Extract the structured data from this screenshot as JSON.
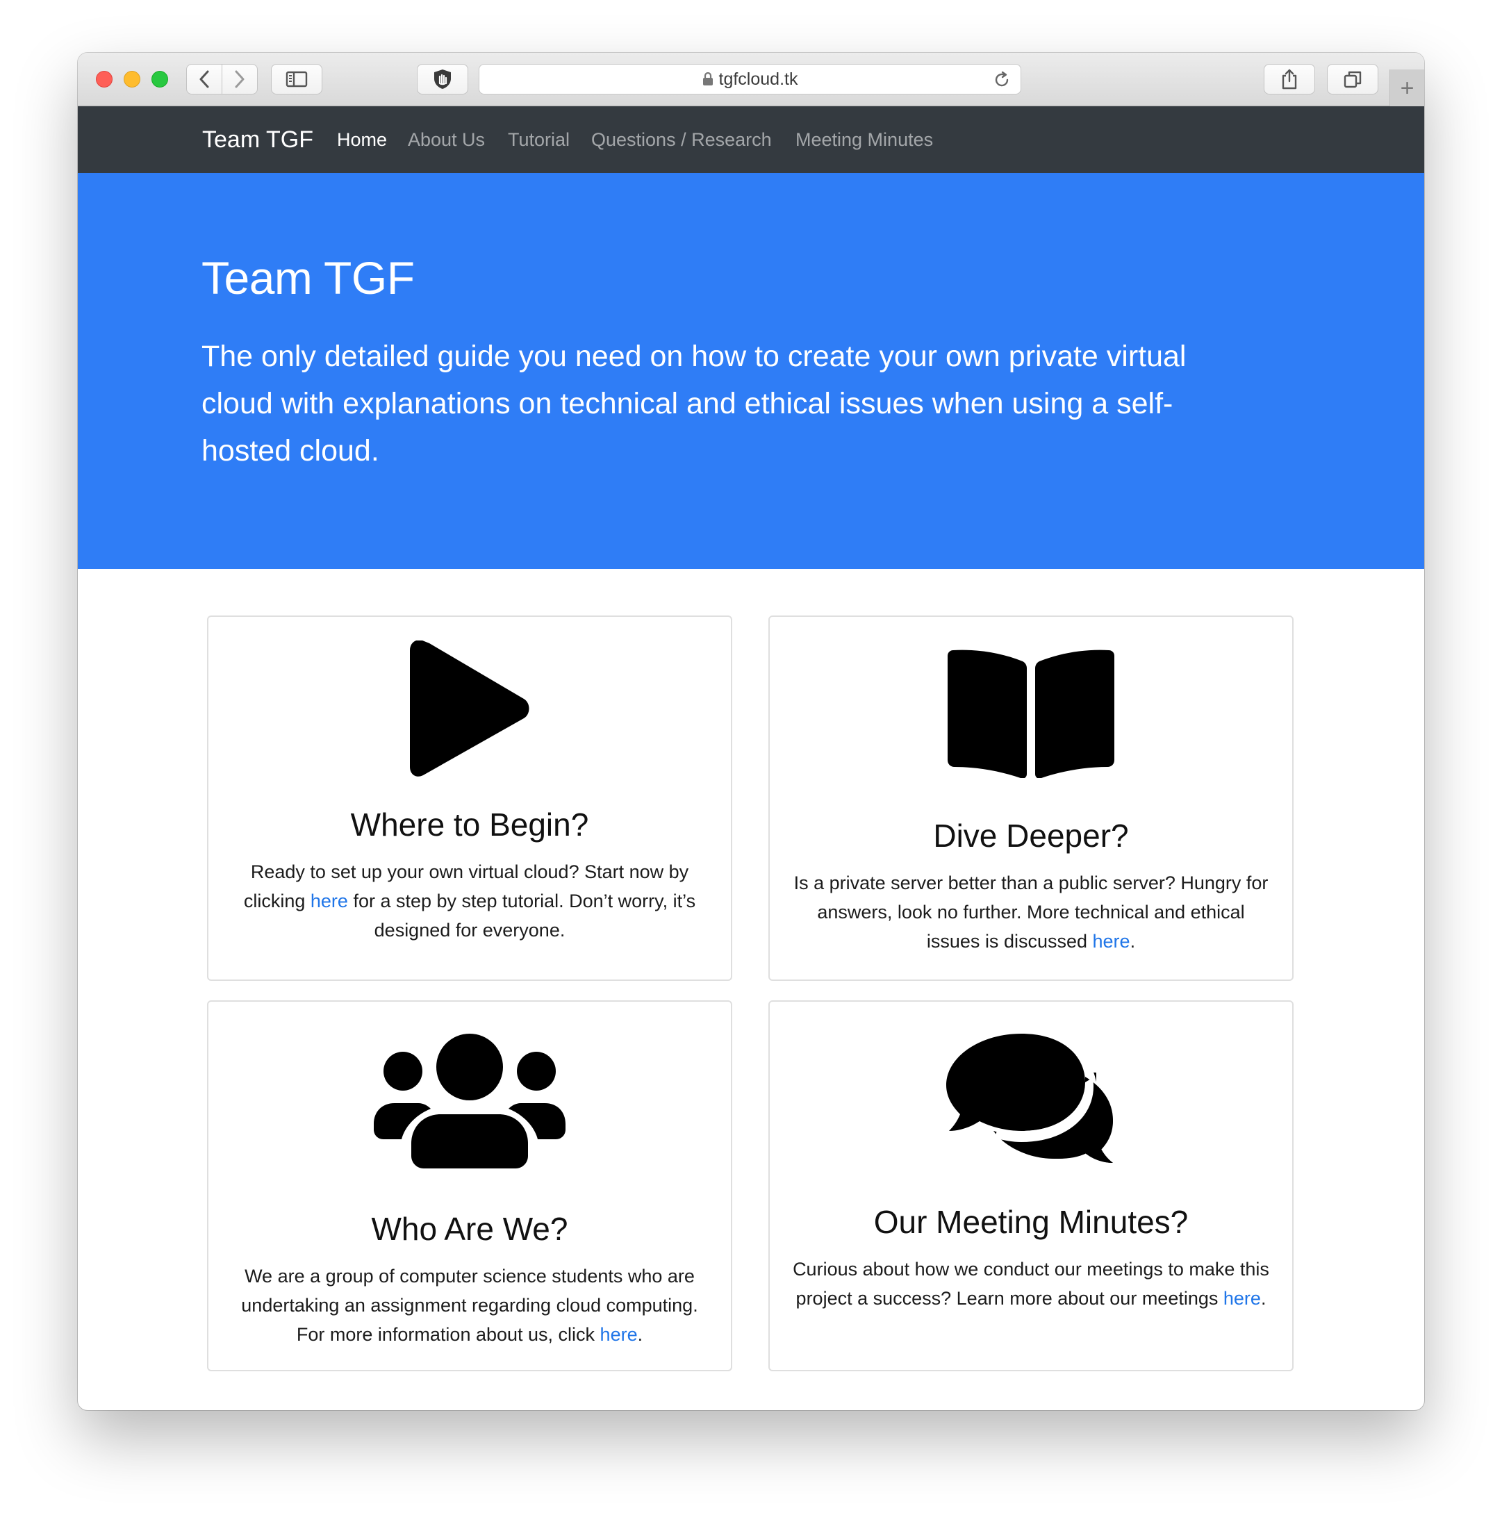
{
  "browser": {
    "url": "tgfcloud.tk",
    "icons": {
      "back": "chevron-left-icon",
      "forward": "chevron-right-icon",
      "sidebar": "sidebar-icon",
      "shield": "hand-shield-icon",
      "lock": "lock-icon",
      "reload": "reload-icon",
      "share": "share-icon",
      "tabs": "tabs-overview-icon",
      "new_tab": "plus-icon"
    },
    "new_tab_label": "+"
  },
  "navbar": {
    "brand": "Team TGF",
    "links": [
      {
        "label": "Home",
        "active": true
      },
      {
        "label": "About Us",
        "active": false
      },
      {
        "label": "Tutorial",
        "active": false
      },
      {
        "label": "Questions / Research",
        "active": false
      },
      {
        "label": "Meeting Minutes",
        "active": false
      }
    ]
  },
  "hero": {
    "title": "Team TGF",
    "lead": "The only detailed guide you need on how to create your own private virtual cloud with explanations on technical and ethical issues when using a self-hosted cloud."
  },
  "cards": [
    {
      "icon": "play-icon",
      "title": "Where to Begin?",
      "text_before": "Ready to set up your own virtual cloud? Start now by clicking ",
      "link": "here",
      "text_after": " for a step by step tutorial. Don’t worry, it’s designed for everyone."
    },
    {
      "icon": "book-icon",
      "title": "Dive Deeper?",
      "text_before": "Is a private server better than a public server? Hungry for answers, look no further. More technical and ethical issues is discussed ",
      "link": "here",
      "text_after": "."
    },
    {
      "icon": "users-icon",
      "title": "Who Are We?",
      "text_before": "We are a group of computer science students who are undertaking an assignment regarding cloud computing. For more information about us, click ",
      "link": "here",
      "text_after": "."
    },
    {
      "icon": "comments-icon",
      "title": "Our Meeting Minutes?",
      "text_before": "Curious about how we conduct our meetings to make this project a success? Learn more about our meetings ",
      "link": "here",
      "text_after": "."
    }
  ],
  "colors": {
    "navbar_bg": "#343a40",
    "hero_bg": "#2f7df6",
    "link": "#1f75e8",
    "close": "#fe5f57",
    "minimize": "#febc2e",
    "maximize": "#28c840"
  }
}
